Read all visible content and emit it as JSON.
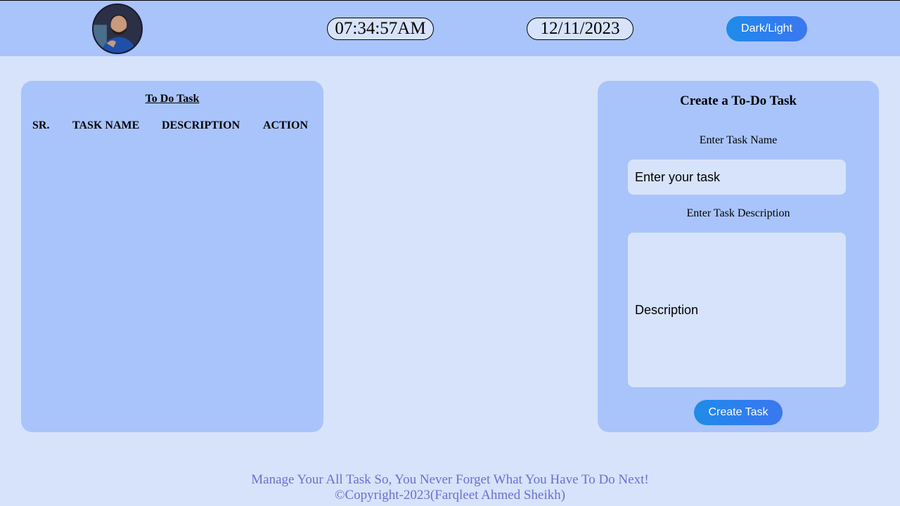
{
  "header": {
    "time": "07:34:57AM",
    "date": "12/11/2023",
    "theme_button": "Dark/Light",
    "avatar_icon": "profile-photo"
  },
  "todo_list": {
    "title": "To Do Task",
    "columns": [
      "SR.",
      "TASK NAME",
      "DESCRIPTION",
      "ACTION"
    ],
    "rows": []
  },
  "create_task": {
    "title": "Create a To-Do Task",
    "name_label": "Enter Task Name",
    "name_placeholder": "Enter your  task",
    "desc_label": "Enter Task Description",
    "desc_placeholder": "Description",
    "submit_label": "Create Task"
  },
  "footer": {
    "tagline": "Manage Your All Task So, You Never Forget What You Have To Do Next!",
    "copyright": "©Copyright-2023(Farqleet Ahmed Sheikh)"
  },
  "colors": {
    "page_bg": "#d7e3fa",
    "panel_bg": "#a9c4fb",
    "button_blue": "#2f7df0",
    "footer_text": "#6b6fd0"
  }
}
